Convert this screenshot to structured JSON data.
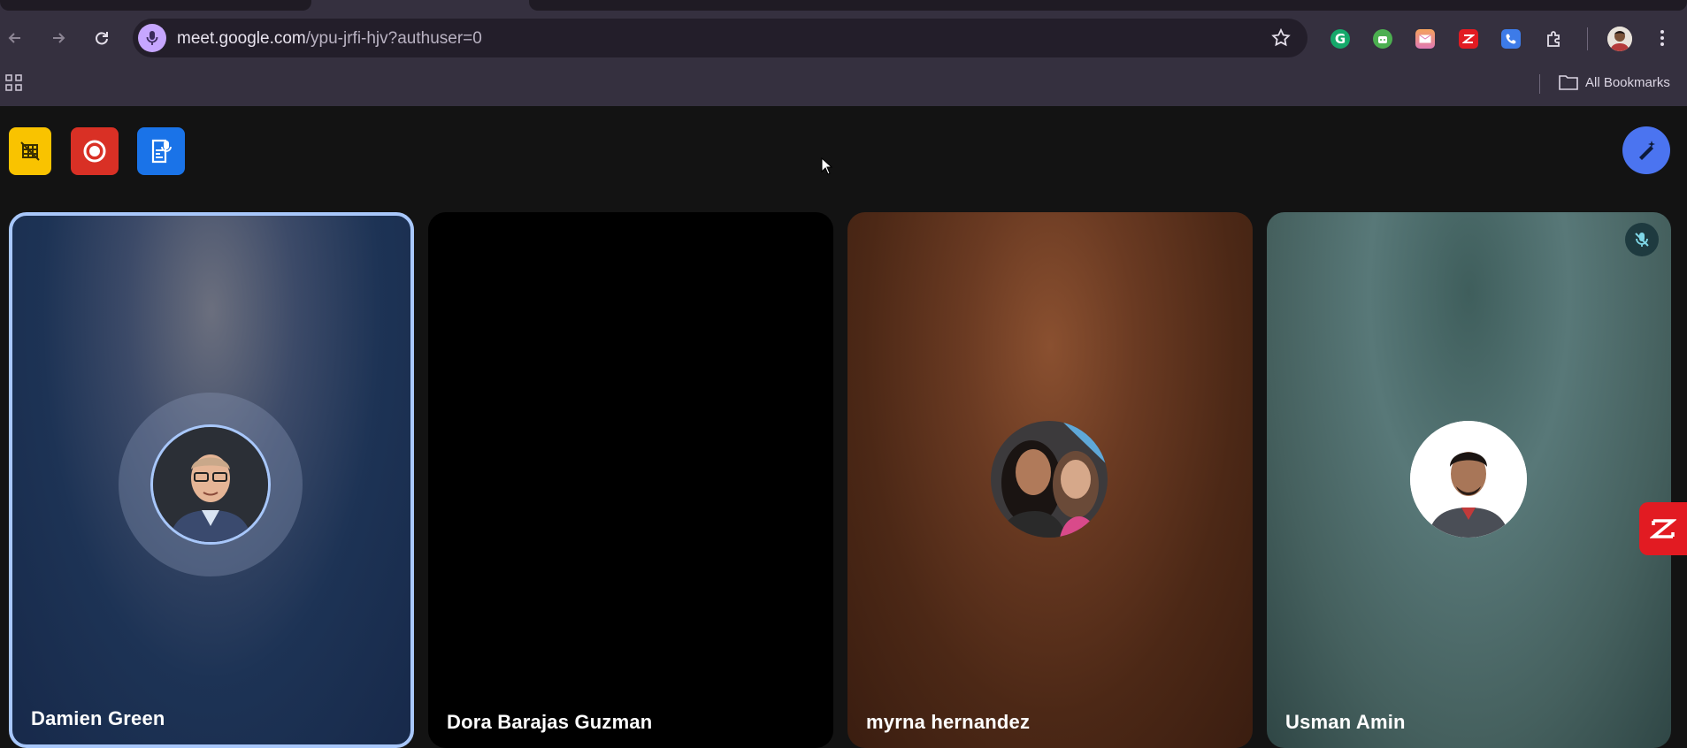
{
  "browser": {
    "url_host": "meet.google.com",
    "url_path": "/ypu-jrfi-hjv?authuser=0",
    "all_bookmarks_label": "All Bookmarks",
    "extensions": [
      "grammarly-icon",
      "android-extension-icon",
      "mail-extension-icon",
      "zoho-extension-icon",
      "phone-extension-icon",
      "puzzle-icon"
    ]
  },
  "meet": {
    "toolbar_buttons": [
      {
        "name": "no-video-grid-button",
        "color": "#f9c300"
      },
      {
        "name": "record-button",
        "color": "#d93025"
      },
      {
        "name": "transcript-button",
        "color": "#1a73e8"
      }
    ],
    "effects_button": {
      "icon": "magic-pen-icon",
      "color": "#4b74f0"
    },
    "participants": [
      {
        "name": "Damien Green",
        "active_speaker": true
      },
      {
        "name": "Dora Barajas Guzman",
        "camera_off": true
      },
      {
        "name": "myrna hernandez"
      },
      {
        "name": "Usman Amin",
        "muted": true
      }
    ]
  }
}
